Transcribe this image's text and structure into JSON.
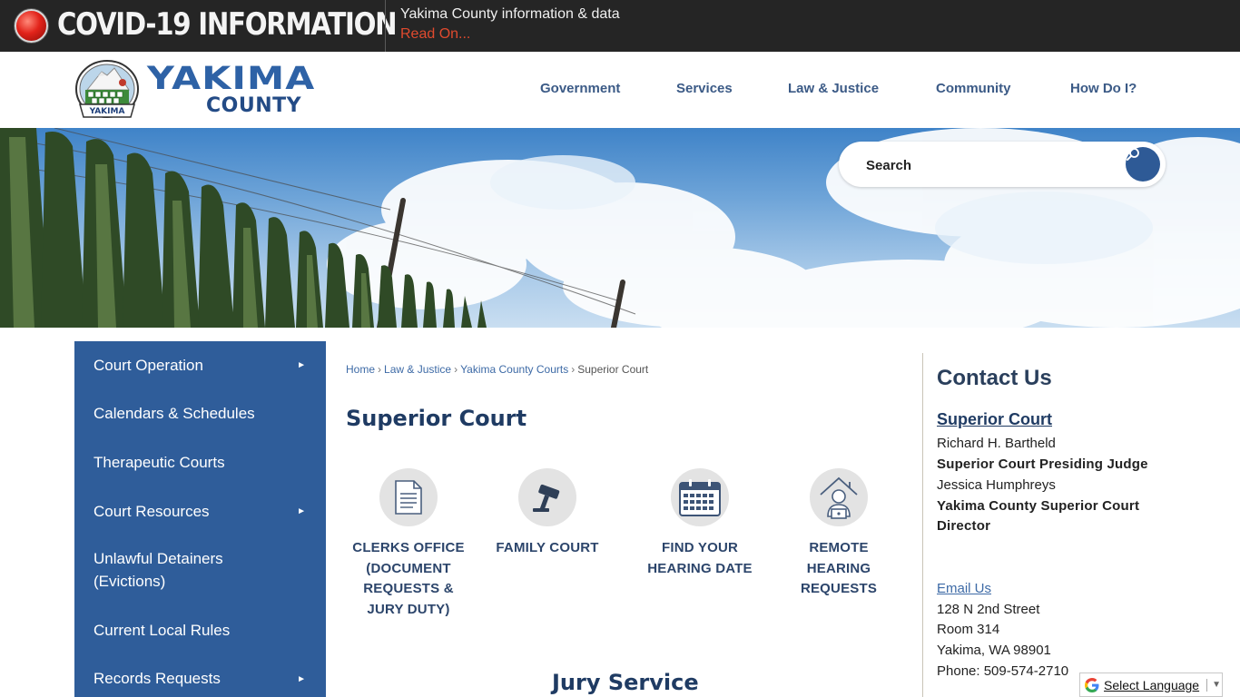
{
  "covid": {
    "title": "COVID-19 INFORMATION",
    "info": "Yakima County information & data",
    "link": "Read On..."
  },
  "logo": {
    "name_line1": "YAKIMA",
    "name_line2": "COUNTY",
    "seal_text": "YAKIMA"
  },
  "nav": {
    "items": [
      {
        "label": "Government"
      },
      {
        "label": "Services"
      },
      {
        "label": "Law & Justice"
      },
      {
        "label": "Community"
      },
      {
        "label": "How Do I?"
      }
    ]
  },
  "search": {
    "placeholder": "Search"
  },
  "sidebar": {
    "items": [
      {
        "label": "Court Operation",
        "has_submenu": true
      },
      {
        "label": "Calendars & Schedules",
        "has_submenu": false
      },
      {
        "label": "Therapeutic Courts",
        "has_submenu": false
      },
      {
        "label": "Court Resources",
        "has_submenu": true
      },
      {
        "label": "Unlawful Detainers (Evictions)",
        "has_submenu": false
      },
      {
        "label": "Current Local Rules",
        "has_submenu": false
      },
      {
        "label": "Records Requests",
        "has_submenu": true
      }
    ],
    "arrow": "►"
  },
  "breadcrumb": {
    "items": [
      {
        "label": "Home"
      },
      {
        "label": "Law & Justice"
      },
      {
        "label": "Yakima County Courts"
      },
      {
        "label": "Superior Court"
      }
    ],
    "separator": "›"
  },
  "page": {
    "title": "Superior Court",
    "section_title": "Jury Service"
  },
  "tiles": [
    {
      "label": "CLERKS OFFICE (DOCUMENT REQUESTS & JURY DUTY)",
      "icon": "document-icon"
    },
    {
      "label": "FAMILY COURT",
      "icon": "gavel-icon"
    },
    {
      "label": "FIND YOUR HEARING DATE",
      "icon": "calendar-icon"
    },
    {
      "label": "REMOTE HEARING REQUESTS",
      "icon": "remote-worker-icon"
    }
  ],
  "contact": {
    "heading": "Contact Us",
    "court_name": "Superior Court",
    "judge_name": "Richard H. Bartheld",
    "judge_title": "Superior Court Presiding Judge",
    "director_name": "Jessica Humphreys",
    "director_title_line1": "Yakima County Superior Court",
    "director_title_line2": "Director",
    "email_label": "Email Us",
    "address_line1": "128 N 2nd Street",
    "address_line2": "Room 314",
    "address_line3": "Yakima, WA 98901",
    "phone": "Phone: 509-574-2710"
  },
  "translate": {
    "label": "Select Language",
    "caret": "▼"
  },
  "colors": {
    "covid_bar": "#252525",
    "covid_link": "#e04a2e",
    "brand_blue": "#2e62a6",
    "nav_text": "#3b5a86",
    "sidebar_bg": "#2f5d9a",
    "title_navy": "#1f3b63",
    "link_blue": "#3d6aa6"
  }
}
